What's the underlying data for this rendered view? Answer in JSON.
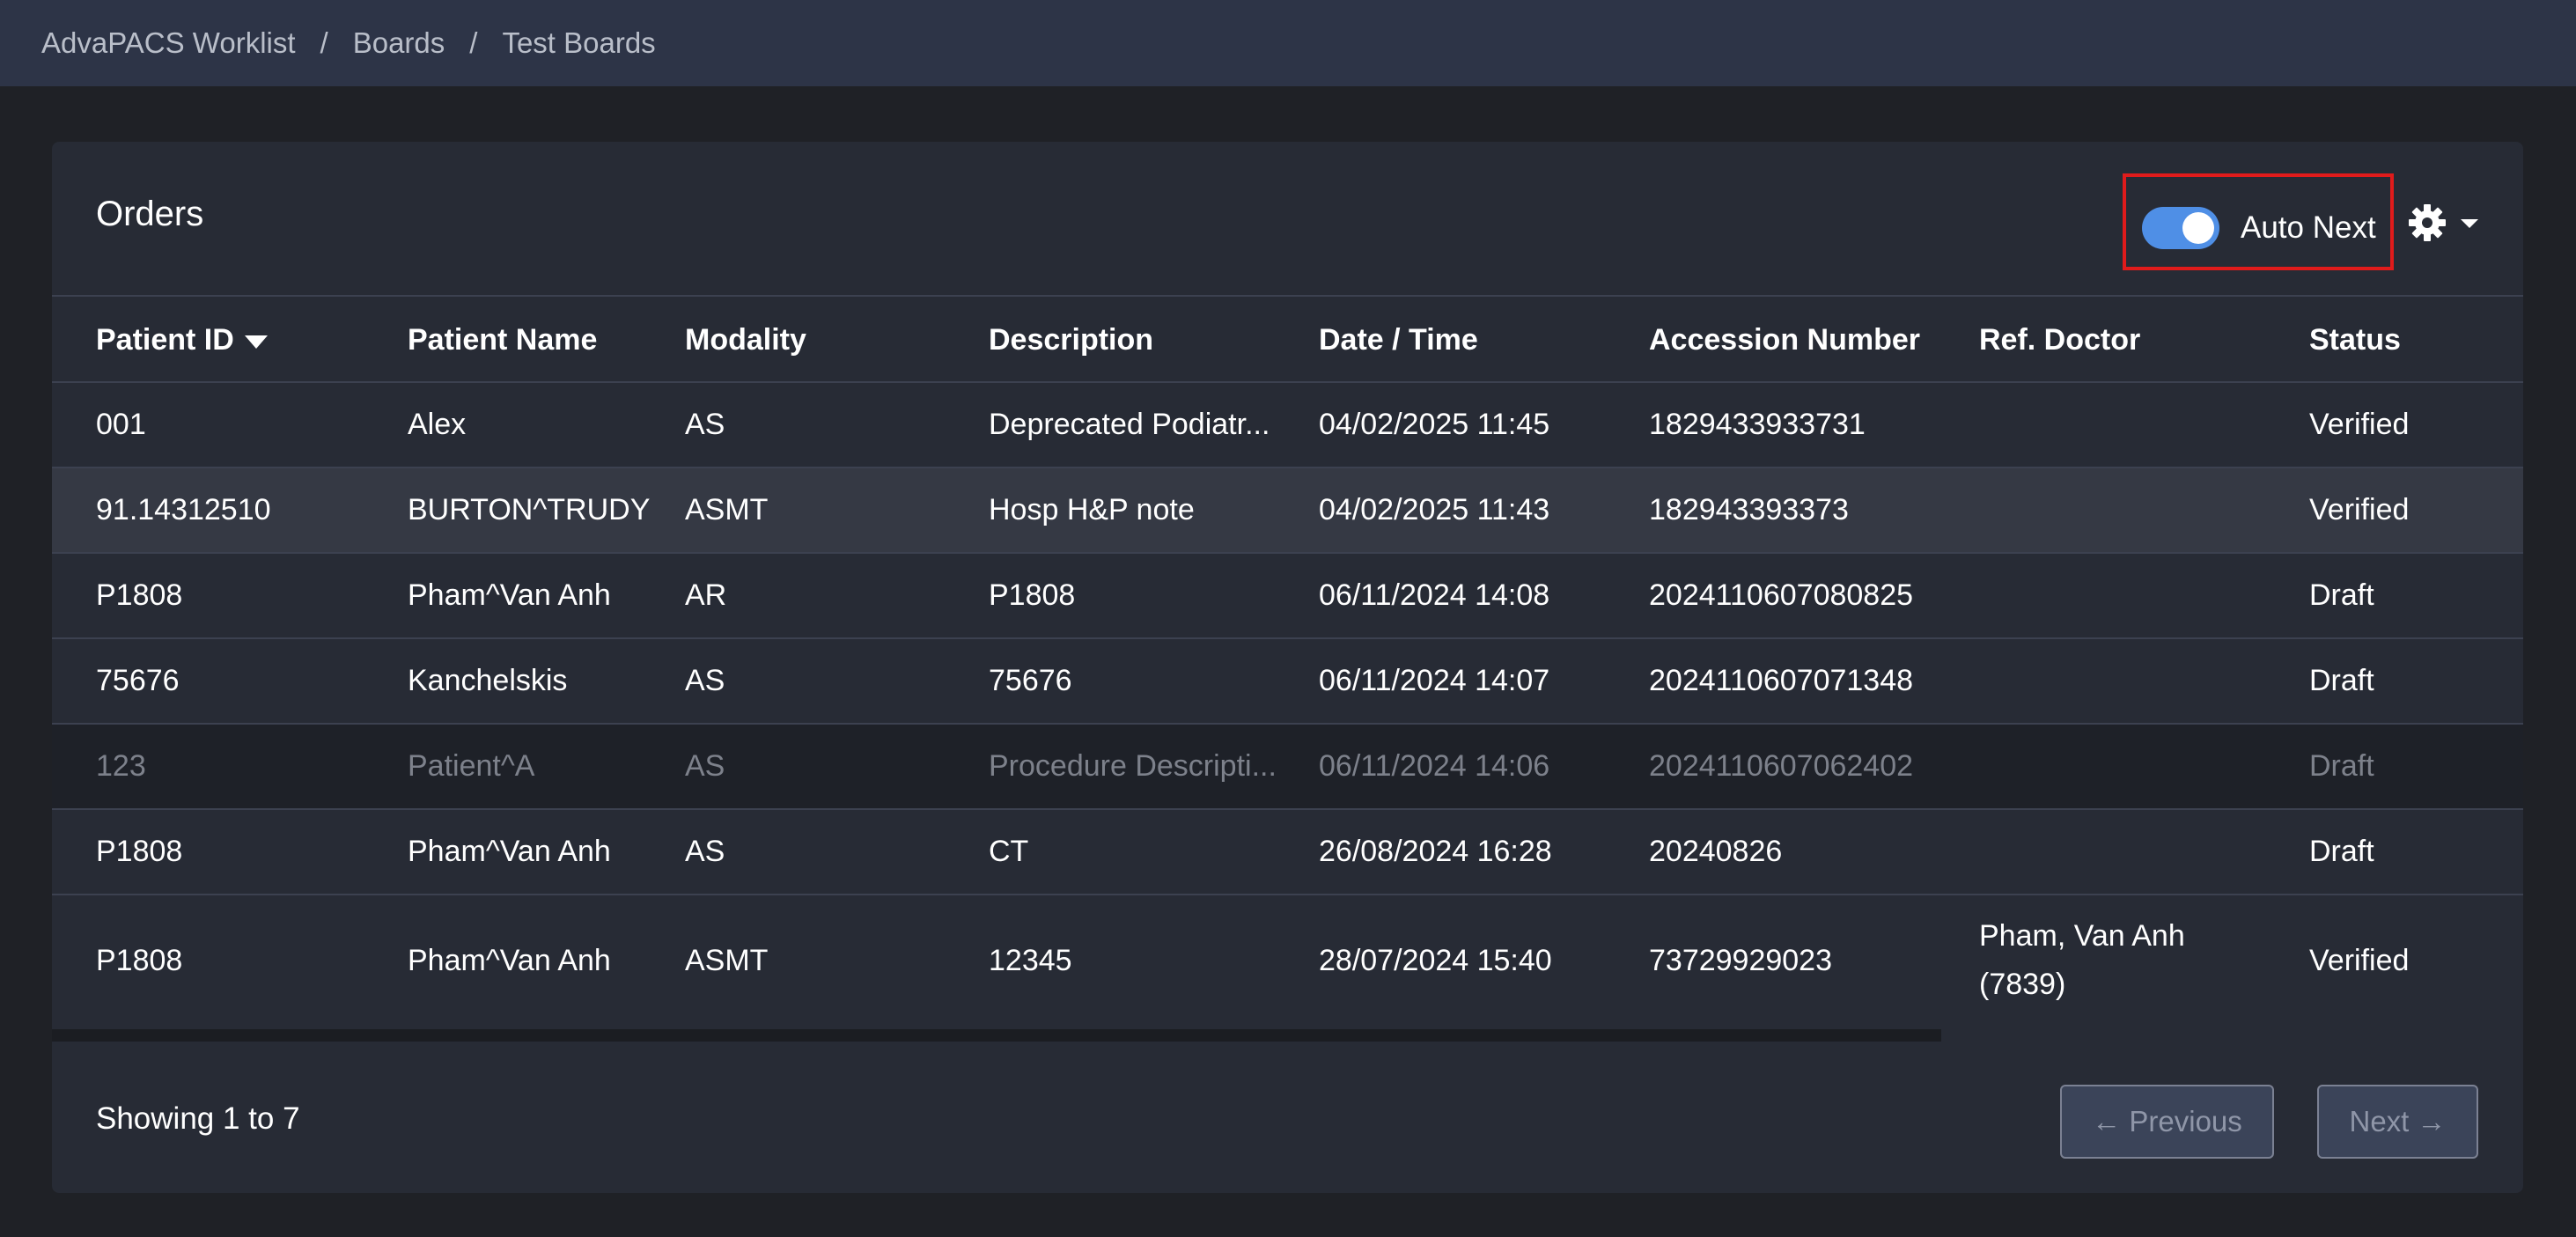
{
  "breadcrumb": {
    "items": [
      "AdvaPACS Worklist",
      "Boards",
      "Test Boards"
    ],
    "separator": "/"
  },
  "card": {
    "title": "Orders",
    "auto_next_label": "Auto Next",
    "auto_next_enabled": true
  },
  "table": {
    "columns": [
      "Patient ID",
      "Patient Name",
      "Modality",
      "Description",
      "Date / Time",
      "Accession Number",
      "Ref. Doctor",
      "Status"
    ],
    "sort_column": "Patient ID",
    "rows": [
      {
        "pid": "001",
        "name": "Alex",
        "modality": "AS",
        "desc": "Deprecated Podiatr...",
        "datetime": "04/02/2025 11:45",
        "accession": "1829433933731",
        "doctor": "",
        "doctor2": "",
        "status": "Verified"
      },
      {
        "pid": "91.14312510",
        "name": "BURTON^TRUDY",
        "modality": "ASMT",
        "desc": "Hosp H&P note",
        "datetime": "04/02/2025 11:43",
        "accession": "182943393373",
        "doctor": "",
        "doctor2": "",
        "status": "Verified"
      },
      {
        "pid": "P1808",
        "name": "Pham^Van Anh",
        "modality": "AR",
        "desc": "P1808",
        "datetime": "06/11/2024 14:08",
        "accession": "2024110607080825",
        "doctor": "",
        "doctor2": "",
        "status": "Draft"
      },
      {
        "pid": "75676",
        "name": "Kanchelskis",
        "modality": "AS",
        "desc": "75676",
        "datetime": "06/11/2024 14:07",
        "accession": "2024110607071348",
        "doctor": "",
        "doctor2": "",
        "status": "Draft"
      },
      {
        "pid": "123",
        "name": "Patient^A",
        "modality": "AS",
        "desc": "Procedure Descripti...",
        "datetime": "06/11/2024 14:06",
        "accession": "2024110607062402",
        "doctor": "",
        "doctor2": "",
        "status": "Draft"
      },
      {
        "pid": "P1808",
        "name": "Pham^Van Anh",
        "modality": "AS",
        "desc": "CT",
        "datetime": "26/08/2024 16:28",
        "accession": "20240826",
        "doctor": "",
        "doctor2": "",
        "status": "Draft"
      },
      {
        "pid": "P1808",
        "name": "Pham^Van Anh",
        "modality": "ASMT",
        "desc": "12345",
        "datetime": "28/07/2024 15:40",
        "accession": "73729929023",
        "doctor": "Pham, Van Anh",
        "doctor2": "(7839)",
        "status": "Verified"
      }
    ]
  },
  "footer": {
    "showing": "Showing 1 to 7",
    "previous_label": "←  Previous",
    "next_label": "Next  →"
  },
  "colors": {
    "topbar_bg": "#2d3447",
    "page_bg": "#1f2126",
    "card_bg": "#272b35",
    "toggle_on": "#4f8fe6",
    "highlight_border": "#e01b1b"
  },
  "icons": {
    "settings": "gear-icon",
    "settings_dropdown": "caret-down-icon",
    "sort": "sort-desc-icon"
  }
}
